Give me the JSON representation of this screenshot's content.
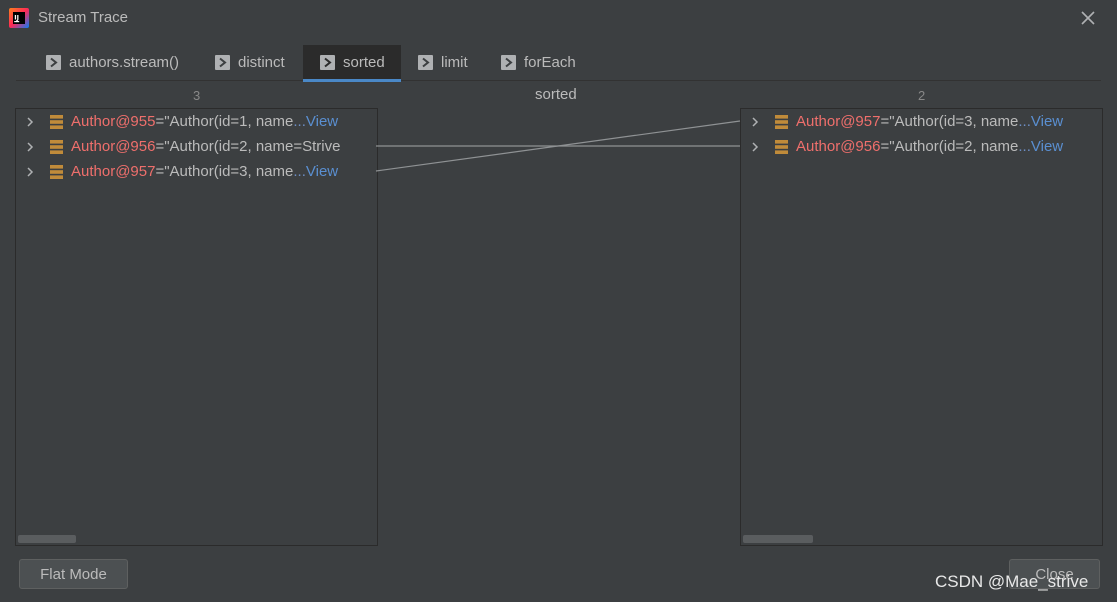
{
  "window": {
    "title": "Stream Trace"
  },
  "tabs": [
    {
      "label": "authors.stream()",
      "icon": "trace-step-icon",
      "active": false
    },
    {
      "label": "distinct",
      "icon": "trace-step-icon",
      "active": false
    },
    {
      "label": "sorted",
      "icon": "trace-step-icon",
      "active": true
    },
    {
      "label": "limit",
      "icon": "trace-step-icon",
      "active": false
    },
    {
      "label": "forEach",
      "icon": "trace-step-icon",
      "active": false
    }
  ],
  "view": {
    "left_count": "3",
    "center_title": "sorted",
    "right_count": "2"
  },
  "left_items": [
    {
      "name": "Author@955",
      "eq": " = ",
      "value": "\"Author(id=1, name",
      "ellipsis": "...",
      "view": "View"
    },
    {
      "name": "Author@956",
      "eq": " = ",
      "value": "\"Author(id=2, name=Strive",
      "ellipsis": "",
      "view": ""
    },
    {
      "name": "Author@957",
      "eq": " = ",
      "value": "\"Author(id=3, name",
      "ellipsis": "...",
      "view": "View"
    }
  ],
  "right_items": [
    {
      "name": "Author@957",
      "eq": " = ",
      "value": "\"Author(id=3, name",
      "ellipsis": "...",
      "view": "View"
    },
    {
      "name": "Author@956",
      "eq": " = ",
      "value": "\"Author(id=2, name",
      "ellipsis": "...",
      "view": "View"
    }
  ],
  "links": [
    {
      "from": "Author@957",
      "to": "Author@957"
    },
    {
      "from": "Author@956",
      "to": "Author@956"
    }
  ],
  "buttons": {
    "flat_mode": "Flat Mode",
    "close": "Close"
  },
  "watermark": "CSDN @Mae_strive",
  "colors": {
    "background": "#3c3f41",
    "active_tab_underline": "#4a88c7",
    "object_name": "#ef6f6c",
    "view_link": "#5a8fd1",
    "object_icon": "#c08b3a"
  }
}
